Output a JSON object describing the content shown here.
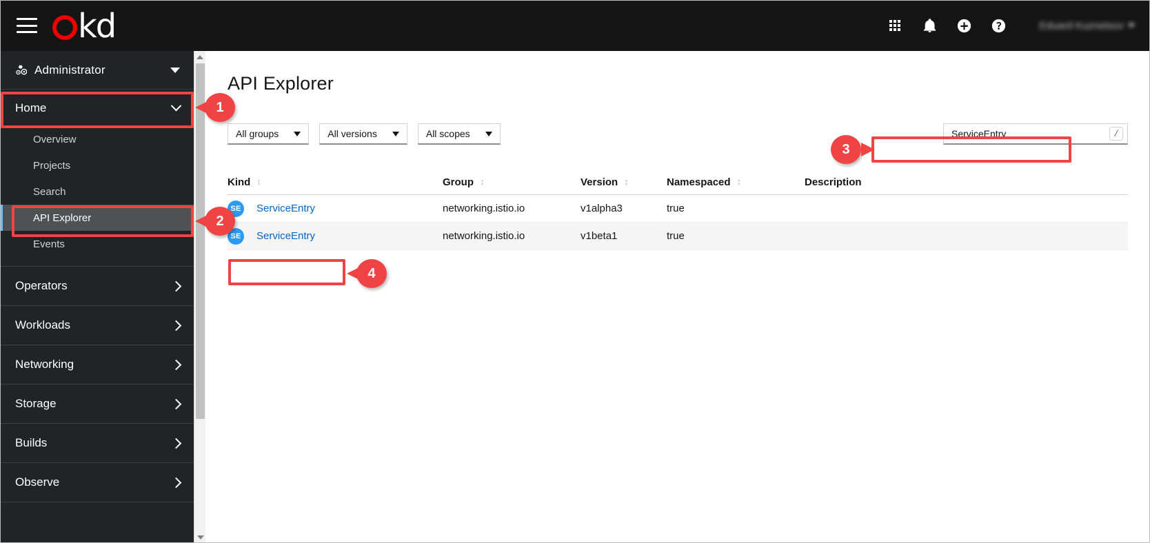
{
  "masthead": {
    "menu_icon": "hamburger-icon",
    "brand": {
      "o": "o",
      "kd": "kd"
    },
    "icons": [
      {
        "name": "application-launcher-icon",
        "glyph": "grid"
      },
      {
        "name": "notifications-bell-icon",
        "glyph": "🔔"
      },
      {
        "name": "add-plus-circle-icon",
        "glyph": "+"
      },
      {
        "name": "help-question-circle-icon",
        "glyph": "?"
      }
    ],
    "user": {
      "name": "Eduard Kuznetsov",
      "caret": "caret-down-icon"
    }
  },
  "sidebar": {
    "perspective": {
      "label": "Administrator",
      "icon": "cogs-icon",
      "caret": "caret-down-icon"
    },
    "home_section": {
      "label": "Home",
      "expanded": true
    },
    "home_items": [
      {
        "label": "Overview",
        "active": false
      },
      {
        "label": "Projects",
        "active": false
      },
      {
        "label": "Search",
        "active": false
      },
      {
        "label": "API Explorer",
        "active": true
      },
      {
        "label": "Events",
        "active": false
      }
    ],
    "groups": [
      {
        "label": "Operators"
      },
      {
        "label": "Workloads"
      },
      {
        "label": "Networking"
      },
      {
        "label": "Storage"
      },
      {
        "label": "Builds"
      },
      {
        "label": "Observe"
      }
    ]
  },
  "main": {
    "page_title": "API Explorer",
    "filters": [
      {
        "label": "All groups",
        "name": "groups-filter"
      },
      {
        "label": "All versions",
        "name": "versions-filter"
      },
      {
        "label": "All scopes",
        "name": "scopes-filter"
      }
    ],
    "search": {
      "value": "ServiceEntry",
      "placeholder": "",
      "shortcut": "/"
    },
    "table": {
      "columns": [
        {
          "label": "Kind",
          "sortable": true
        },
        {
          "label": "Group",
          "sortable": true
        },
        {
          "label": "Version",
          "sortable": true
        },
        {
          "label": "Namespaced",
          "sortable": true
        },
        {
          "label": "Description",
          "sortable": false
        }
      ],
      "rows": [
        {
          "badge": "SE",
          "kind": "ServiceEntry",
          "group": "networking.istio.io",
          "version": "v1alpha3",
          "namespaced": "true",
          "description": ""
        },
        {
          "badge": "SE",
          "kind": "ServiceEntry",
          "group": "networking.istio.io",
          "version": "v1beta1",
          "namespaced": "true",
          "description": ""
        }
      ]
    }
  },
  "annotations": [
    {
      "number": "1",
      "target": "sidebar-home-section"
    },
    {
      "number": "2",
      "target": "sidebar-item-api-explorer"
    },
    {
      "number": "3",
      "target": "search-input"
    },
    {
      "number": "4",
      "target": "table-row-v1beta1-kind"
    }
  ],
  "colors": {
    "masthead_bg": "#151515",
    "sidebar_bg": "#212427",
    "accent_red": "#ee0000",
    "annotation_red": "#f04444",
    "link_blue": "#06c",
    "badge_blue": "#2b9af3",
    "active_border": "#73bcf7"
  }
}
